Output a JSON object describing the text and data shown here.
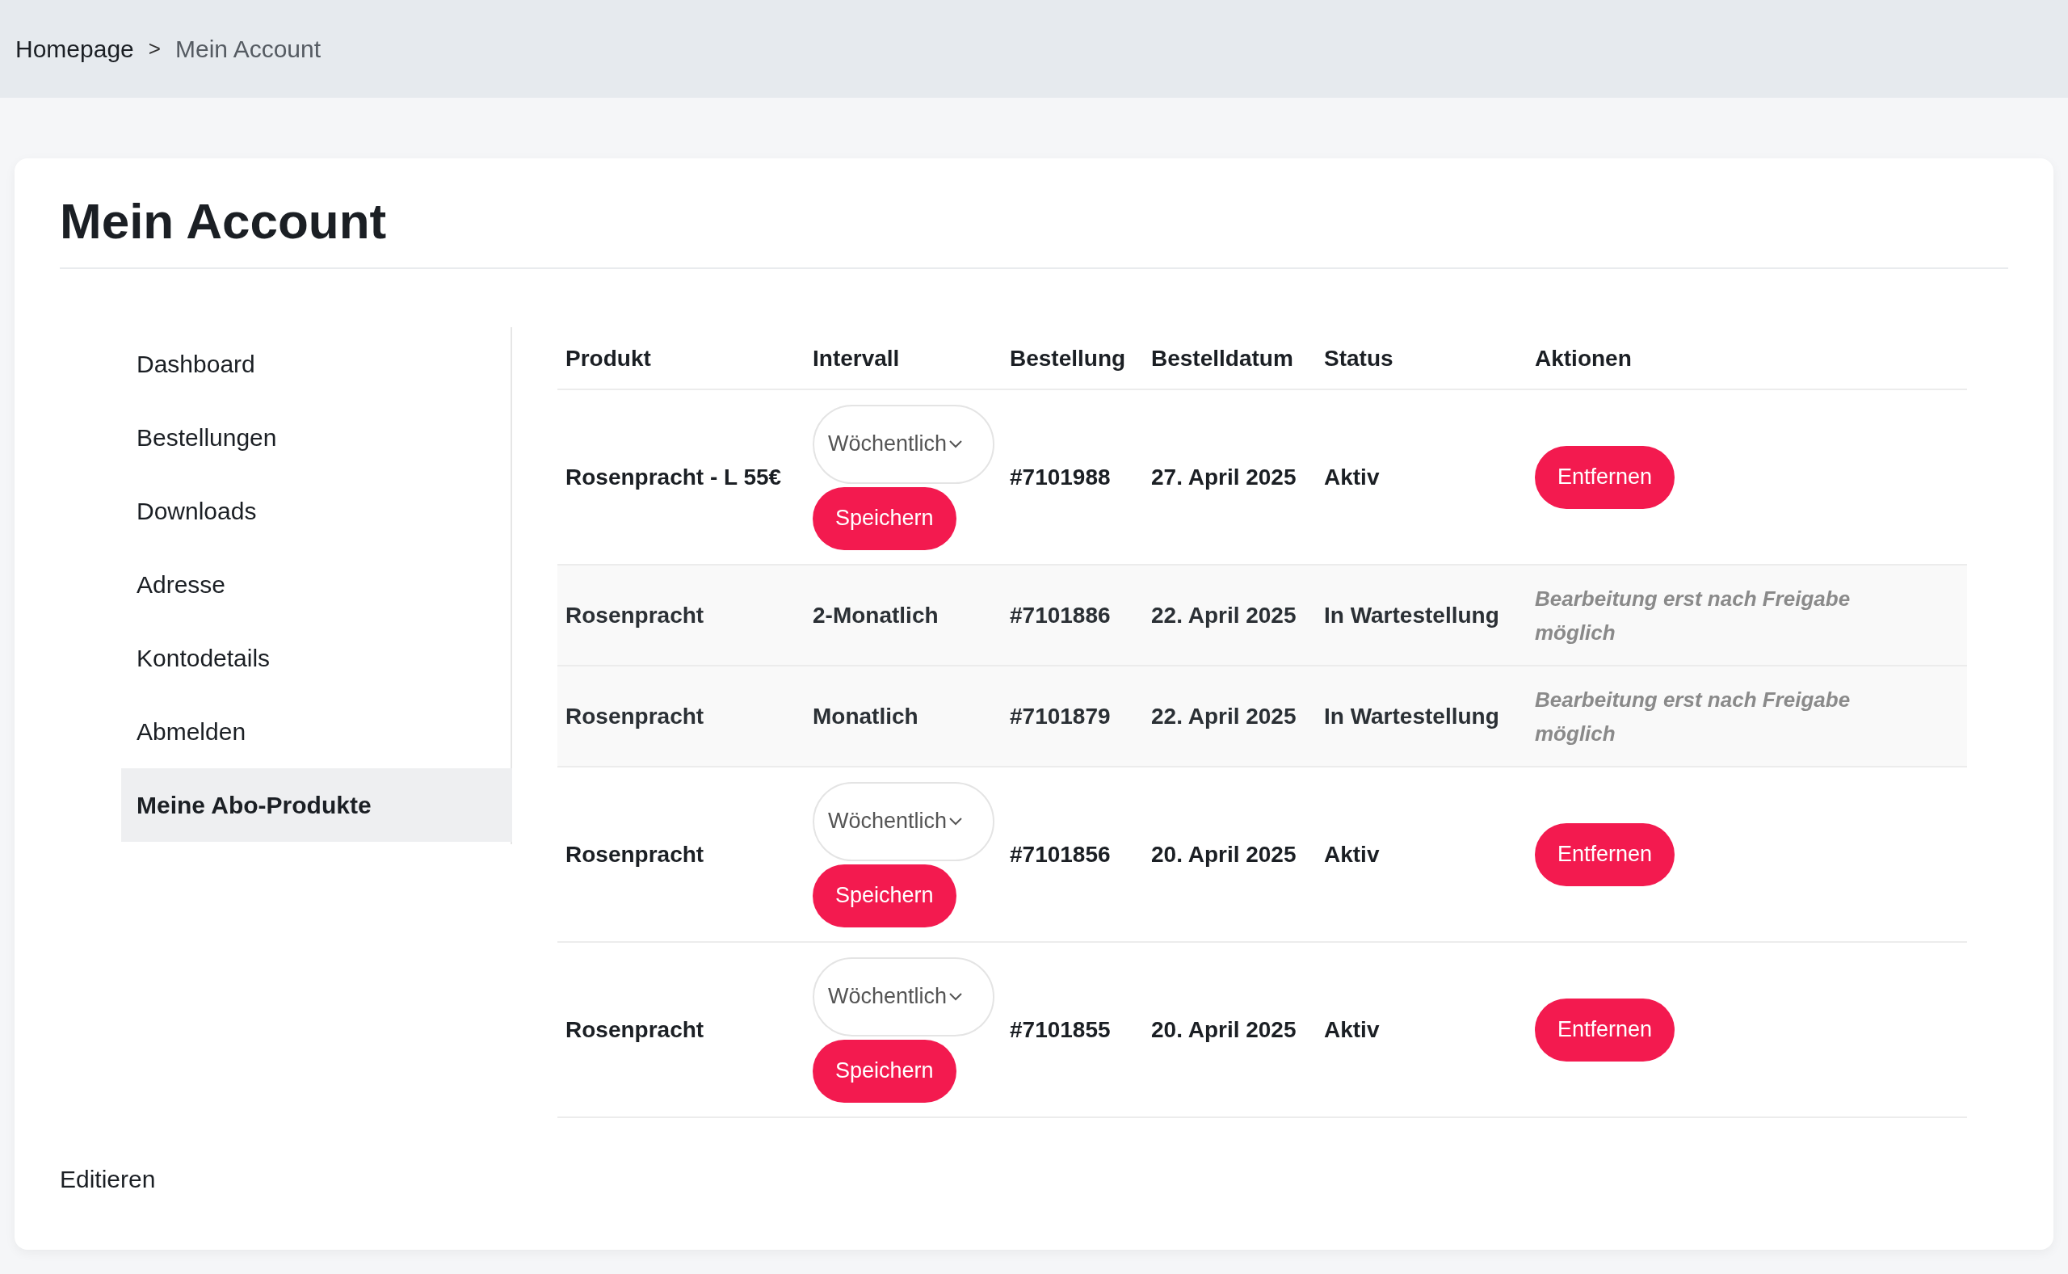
{
  "breadcrumb": {
    "items": [
      {
        "label": "Homepage"
      },
      {
        "label": "Mein Account"
      }
    ],
    "separator": ">"
  },
  "page": {
    "title": "Mein Account"
  },
  "sidebar": {
    "items": [
      {
        "label": "Dashboard",
        "selected": false
      },
      {
        "label": "Bestellungen",
        "selected": false
      },
      {
        "label": "Downloads",
        "selected": false
      },
      {
        "label": "Adresse",
        "selected": false
      },
      {
        "label": "Kontodetails",
        "selected": false
      },
      {
        "label": "Abmelden",
        "selected": false
      },
      {
        "label": "Meine Abo-Produkte",
        "selected": true
      }
    ]
  },
  "table": {
    "columns": [
      "Produkt",
      "Intervall",
      "Bestellung",
      "Bestelldatum",
      "Status",
      "Aktionen"
    ],
    "rows": [
      {
        "kind": "editable",
        "product": "Rosenpracht - L 55€",
        "interval": "Wöchentlich",
        "save": "Speichern",
        "order": "#7101988",
        "date": "27. April 2025",
        "status": "Aktiv",
        "action": "Entfernen"
      },
      {
        "kind": "pending",
        "product": "Rosenpracht",
        "interval": "2-Monatlich",
        "order": "#7101886",
        "date": "22. April 2025",
        "status": "In Wartestellung",
        "note": "Bearbeitung erst nach Freigabe möglich"
      },
      {
        "kind": "pending",
        "product": "Rosenpracht",
        "interval": "Monatlich",
        "order": "#7101879",
        "date": "22. April 2025",
        "status": "In Wartestellung",
        "note": "Bearbeitung erst nach Freigabe möglich"
      },
      {
        "kind": "editable",
        "product": "Rosenpracht",
        "interval": "Wöchentlich",
        "save": "Speichern",
        "order": "#7101856",
        "date": "20. April 2025",
        "status": "Aktiv",
        "action": "Entfernen"
      },
      {
        "kind": "editable",
        "product": "Rosenpracht",
        "interval": "Wöchentlich",
        "save": "Speichern",
        "order": "#7101855",
        "date": "20. April 2025",
        "status": "Aktiv",
        "action": "Entfernen"
      }
    ]
  },
  "footer_link": "Editieren"
}
